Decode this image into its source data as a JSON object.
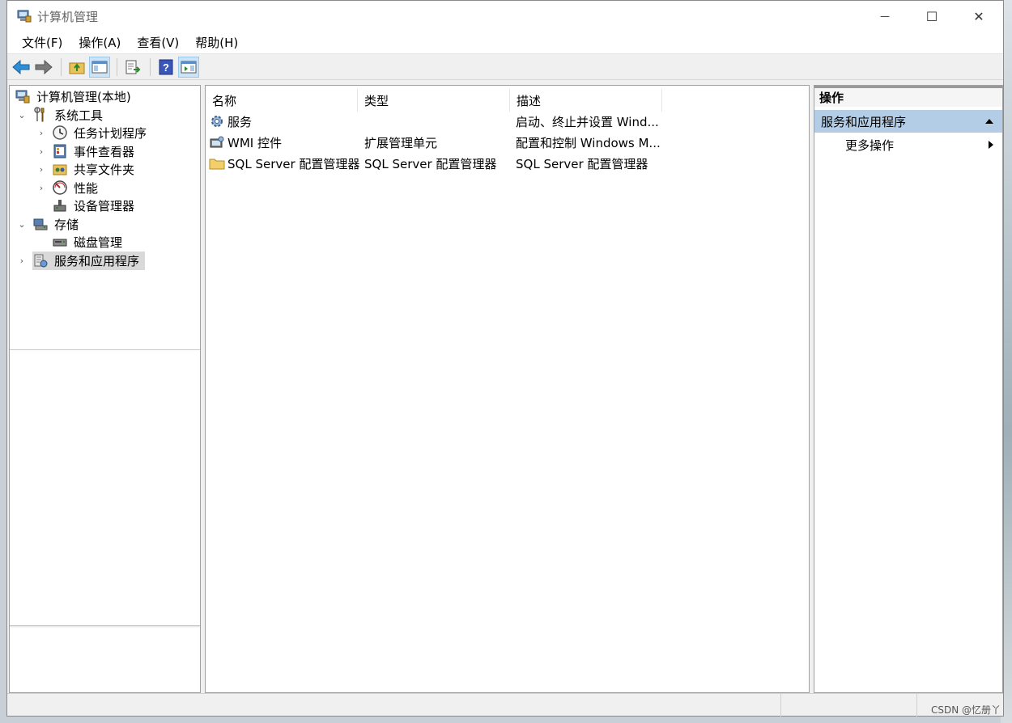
{
  "window": {
    "title": "计算机管理"
  },
  "window_controls": {
    "minimize": "—",
    "maximize": "☐",
    "close": "✕"
  },
  "menu": [
    "文件(F)",
    "操作(A)",
    "查看(V)",
    "帮助(H)"
  ],
  "tree": [
    {
      "label": "计算机管理(本地)",
      "expander": "",
      "icon": "computer-management-icon"
    },
    {
      "label": "系统工具",
      "expander": "⌄",
      "icon": "system-tools-icon"
    },
    {
      "label": "任务计划程序",
      "expander": "›",
      "icon": "clock-icon"
    },
    {
      "label": "事件查看器",
      "expander": "›",
      "icon": "event-viewer-icon"
    },
    {
      "label": "共享文件夹",
      "expander": "›",
      "icon": "shared-folder-icon"
    },
    {
      "label": "性能",
      "expander": "›",
      "icon": "performance-icon"
    },
    {
      "label": "设备管理器",
      "expander": "",
      "icon": "device-manager-icon"
    },
    {
      "label": "存储",
      "expander": "⌄",
      "icon": "storage-icon"
    },
    {
      "label": "磁盘管理",
      "expander": "",
      "icon": "disk-management-icon"
    },
    {
      "label": "服务和应用程序",
      "expander": "›",
      "icon": "services-apps-icon"
    }
  ],
  "list": {
    "columns": [
      "名称",
      "类型",
      "描述"
    ],
    "rows": [
      {
        "name": "服务",
        "type": "",
        "desc": "启动、终止并设置 Wind...",
        "icon": "services-gear-icon"
      },
      {
        "name": "WMI 控件",
        "type": "扩展管理单元",
        "desc": "配置和控制 Windows M...",
        "icon": "wmi-icon"
      },
      {
        "name": "SQL Server 配置管理器",
        "type": "SQL Server 配置管理器",
        "desc": "SQL Server 配置管理器",
        "icon": "folder-icon"
      }
    ]
  },
  "actions": {
    "header": "操作",
    "section": "服务和应用程序",
    "more": "更多操作"
  },
  "watermark": "CSDN @忆册丫"
}
